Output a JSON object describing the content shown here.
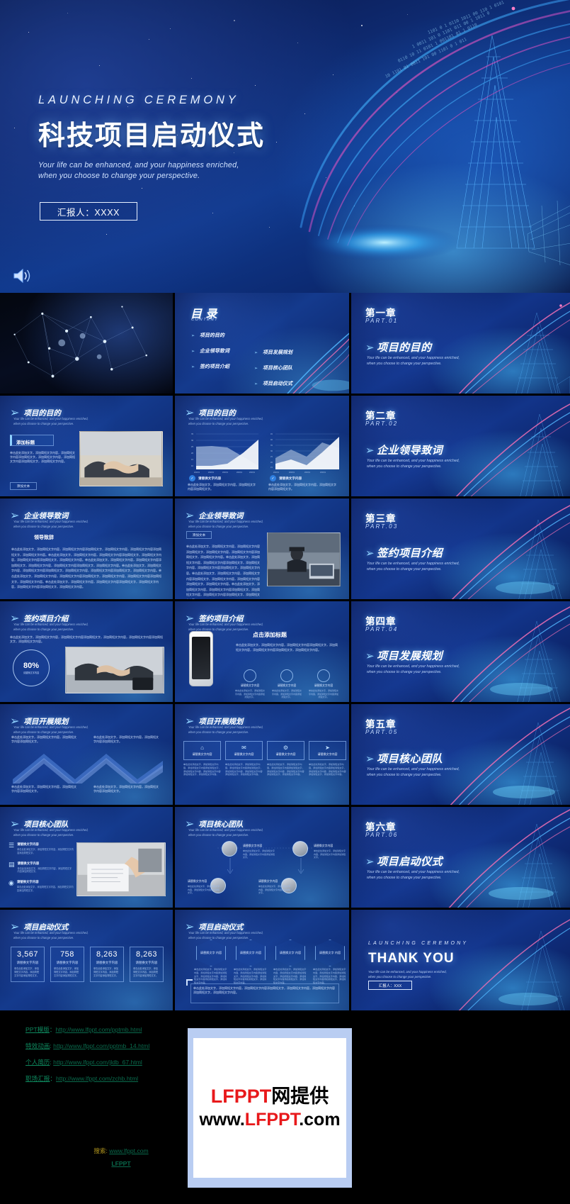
{
  "hero": {
    "eyebrow": "LAUNCHING CEREMONY",
    "title": "科技项目启动仪式",
    "subtitle_line1": "Your life can be enhanced, and your happiness enriched,",
    "subtitle_line2": "when you choose to change your perspective.",
    "reporter": "汇报人：XXXX",
    "speaker_icon": "speaker-icon"
  },
  "common": {
    "en_sub_line1": "Your life can be enhanced, and your happiness enriched,",
    "en_sub_line2": "when you choose to change your perspective.",
    "arrow": "➢",
    "body_cn": "单击此处添加文字，添加简短文字内容，添加简短文字内容添加简短文字，添加简短文字内容，添加简短文字内容添加简短文字，添加简短文字内容。",
    "body_short": "单击此处添加文字，添加简短文字内容，添加简短文字内容添加简短文字。",
    "placeholder_label": "请替换文字内容",
    "placeholder_hex": "请替换文字内容"
  },
  "slides": [
    {
      "n": 1,
      "kind": "cover-dark",
      "title": "",
      "eyebrow": ""
    },
    {
      "n": 2,
      "kind": "toc",
      "title": "目 录",
      "eyebrow": "CONTENT",
      "items_left": [
        "项目的目的",
        "企业领导致词",
        "签约项目介绍"
      ],
      "items_right": [
        "项目发展规划",
        "项目核心团队",
        "项目启动仪式"
      ]
    },
    {
      "n": 3,
      "kind": "chapter",
      "chapter": "第一章",
      "part": "PART.01",
      "heading": "项目的目的"
    },
    {
      "n": 4,
      "kind": "content-photo",
      "title": "项目的目的",
      "box_label": "添加标题",
      "btn_label": "添加文本"
    },
    {
      "n": 5,
      "kind": "content-charts",
      "title": "项目的目的",
      "check_label_left": "请替换文字内容",
      "check_label_right": "请替换文字内容"
    },
    {
      "n": 6,
      "kind": "chapter",
      "chapter": "第二章",
      "part": "PART.02",
      "heading": "企业领导致词"
    },
    {
      "n": 7,
      "kind": "content-text",
      "title": "企业领导致词",
      "sub_label": "领导致辞"
    },
    {
      "n": 8,
      "kind": "content-photo2",
      "title": "企业领导致词",
      "box_label": "添加文本"
    },
    {
      "n": 9,
      "kind": "chapter",
      "chapter": "第三章",
      "part": "PART.03",
      "heading": "签约项目介绍"
    },
    {
      "n": 10,
      "kind": "content-ring",
      "title": "签约项目介绍",
      "ring_value": "80%",
      "ring_caption": "请替换文字内容"
    },
    {
      "n": 11,
      "kind": "content-phone",
      "title": "签约项目介绍",
      "headline": "点击添加标题",
      "tiles": [
        "请替换文字内容",
        "请替换文字内容",
        "请替换文字内容"
      ]
    },
    {
      "n": 12,
      "kind": "chapter",
      "chapter": "第四章",
      "part": "PART.04",
      "heading": "项目发展规划"
    },
    {
      "n": 13,
      "kind": "content-zigzag",
      "title": "项目开展规划"
    },
    {
      "n": 14,
      "kind": "content-icons4",
      "title": "项目开展规划",
      "tiles": [
        "请替换文字内容",
        "请替换文字内容",
        "请替换文字内容",
        "请替换文字内容"
      ],
      "icons": [
        "home-icon",
        "chat-icon",
        "gear-icon",
        "rocket-icon"
      ]
    },
    {
      "n": 15,
      "kind": "chapter",
      "chapter": "第五章",
      "part": "PART.05",
      "heading": "项目核心团队"
    },
    {
      "n": 16,
      "kind": "content-list-photo",
      "title": "项目核心团队",
      "rows": [
        "请替换文字内容",
        "请替换文字内容",
        "请替换文字内容"
      ],
      "icons": [
        "list-icon",
        "chart-icon",
        "bulb-icon"
      ]
    },
    {
      "n": 17,
      "kind": "content-team",
      "title": "项目核心团队",
      "members": [
        "请替换文字内容",
        "请替换文字内容",
        "请替换文字内容",
        "请替换文字内容"
      ]
    },
    {
      "n": 18,
      "kind": "chapter",
      "chapter": "第六章",
      "part": "PART.06",
      "heading": "项目启动仪式"
    },
    {
      "n": 19,
      "kind": "content-stats",
      "title": "项目启动仪式",
      "stats": [
        {
          "value": "3,567",
          "label": "请替换文字内容"
        },
        {
          "value": "758",
          "label": "请替换文字内容"
        },
        {
          "value": "8,263",
          "label": "请替换文字内容"
        },
        {
          "value": "8,263",
          "label": "请替换文字内容"
        }
      ]
    },
    {
      "n": 20,
      "kind": "content-hex",
      "title": "项目启动仪式",
      "hexes": [
        "请替换文字\n内容",
        "请替换文字\n内容",
        "请替换文字\n内容",
        "请替换文字\n内容"
      ]
    },
    {
      "n": 21,
      "kind": "thankyou",
      "eyebrow": "LAUNCHING CEREMONY",
      "title": "THANK YOU",
      "reporter": "汇报人：XXX"
    }
  ],
  "footer": {
    "links": [
      {
        "cn": "PPT模版",
        "sep": "：",
        "url": "http://www.lfppt.com/pptmb.html"
      },
      {
        "cn": "特效动画",
        "sep": ": ",
        "url": "http://www.lfppt.com/pptmb_14.html"
      },
      {
        "cn": "个人简历",
        "sep": ": ",
        "url": "http://www.lfppt.com/jldb_67.html"
      },
      {
        "cn": "职场汇报",
        "sep": "：",
        "url": "http://www.lfppt.com/zchb.html"
      }
    ],
    "search_label": "搜索:",
    "search_url": "www.lfppt.com",
    "search_brand": "LFPPT",
    "watermark_line1_a": "LFPPT",
    "watermark_line1_b": "网提供",
    "watermark_line2_a": "www.",
    "watermark_line2_b": "LFPPT",
    "watermark_line2_c": ".com"
  },
  "colors": {
    "deep_blue": "#0a1b52",
    "mid_blue": "#143a8d",
    "glow_cyan": "#5ac8ff",
    "ribbon_pink": "#e0559c",
    "accent_white": "#ffffff",
    "link_green": "#0e8a5f",
    "watermark_red": "#e8191b"
  }
}
